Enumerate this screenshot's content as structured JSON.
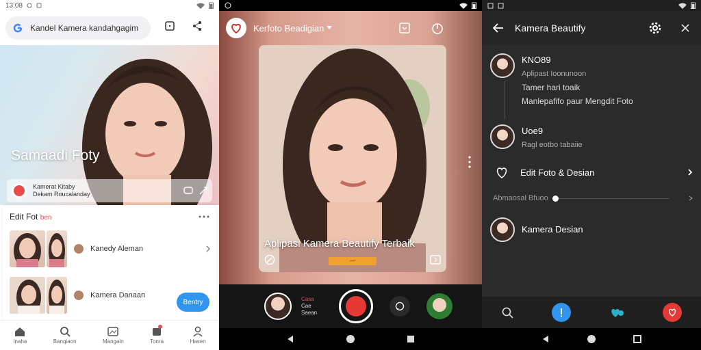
{
  "screen1": {
    "status": {
      "time": "13:08"
    },
    "search": {
      "value": "Kandel Kamera kandahgagim"
    },
    "hero": {
      "title": "Samaadi Foty",
      "card_line1": "Kamerat Kitaby",
      "card_line2": "Dekam Roucalanday"
    },
    "panel": {
      "heading": "Edit Fot",
      "heading_accent": "ben",
      "rows": [
        {
          "label": "Kanedy Aleman"
        },
        {
          "label": "Kamera Danaan"
        }
      ],
      "follow_label": "Bentry"
    },
    "nav": [
      {
        "label": "Inaha",
        "icon": "home-icon"
      },
      {
        "label": "Banqiaon",
        "icon": "search-icon"
      },
      {
        "label": "Mangain",
        "icon": "gallery-icon"
      },
      {
        "label": "Tonra",
        "icon": "notifications-icon"
      },
      {
        "label": "Hasen",
        "icon": "profile-icon"
      }
    ]
  },
  "screen2": {
    "app_title": "Kerfoto Beadigian",
    "caption": "Aplipasi Kamera Beautify Terbaik",
    "pill_text": "—",
    "cam_labels": {
      "line1": "Casa",
      "line2": "Cae",
      "line3": "Saean"
    }
  },
  "screen3": {
    "header_title": "Kamera Beautify",
    "items": [
      {
        "name": "KNO89",
        "lines": [
          "Aplipast Ioonunoon",
          "Tamer hari toaik",
          "Manlepafifo paur Mengdit Foto"
        ]
      },
      {
        "name": "Uoe9",
        "lines": [
          "Ragl eotbo tabaiie"
        ]
      }
    ],
    "edit_row": "Edit Foto & Desian",
    "slider_label": "Abmaosal Bfuoo",
    "slider_value": 0,
    "camera_design": "Kamera Desian"
  },
  "colors": {
    "accent_blue": "#2f95ee",
    "record_red": "#e53935",
    "dark_bg": "#2b2b2b"
  }
}
